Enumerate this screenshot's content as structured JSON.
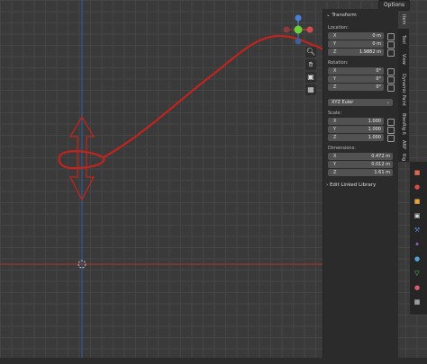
{
  "header": {
    "options_label": "Options"
  },
  "transform": {
    "title": "Transform",
    "location_label": "Location:",
    "location": [
      {
        "axis": "X",
        "value": "0 m"
      },
      {
        "axis": "Y",
        "value": "0 m"
      },
      {
        "axis": "Z",
        "value": "1.9882 m"
      }
    ],
    "rotation_label": "Rotation:",
    "rotation": [
      {
        "axis": "X",
        "value": "0°"
      },
      {
        "axis": "Y",
        "value": "0°"
      },
      {
        "axis": "Z",
        "value": "0°"
      }
    ],
    "rotation_mode": "XYZ Euler",
    "scale_label": "Scale:",
    "scale": [
      {
        "axis": "X",
        "value": "1.000"
      },
      {
        "axis": "Y",
        "value": "1.000"
      },
      {
        "axis": "Z",
        "value": "1.000"
      }
    ],
    "dimensions_label": "Dimensions:",
    "dimensions": [
      {
        "axis": "X",
        "value": "0.472 m"
      },
      {
        "axis": "Y",
        "value": "0.012 m"
      },
      {
        "axis": "Z",
        "value": "1.61 m"
      }
    ]
  },
  "edit_linked_library": "Edit Linked Library",
  "sidebar_tabs": [
    "Item",
    "Tool",
    "View",
    "Dynamic Paint",
    "BlenRig 6",
    "ARP",
    "Rig Tools"
  ],
  "gizmo": {
    "axis_x": "X",
    "axis_y": "Y",
    "axis_z": "Z"
  },
  "colors": {
    "annotation": "#c0241f",
    "x_axis": "#b83333",
    "z_axis": "#2e5fa5"
  }
}
